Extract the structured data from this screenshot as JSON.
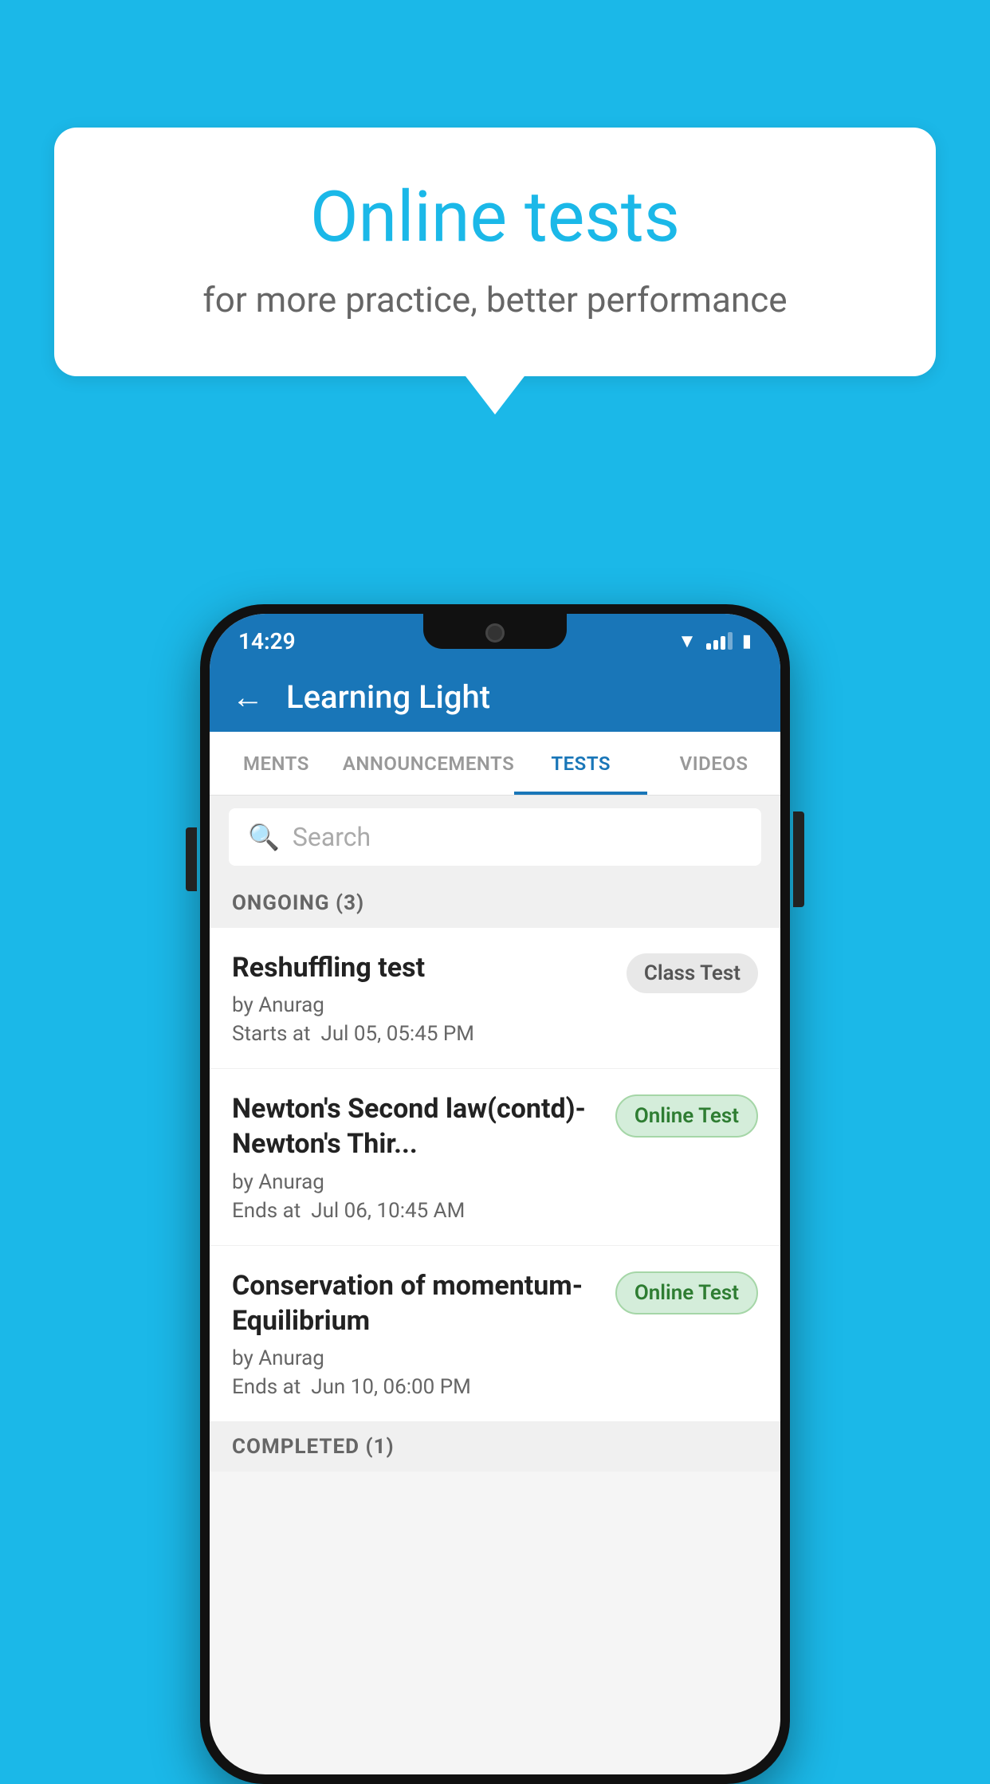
{
  "background": {
    "color": "#1BB8E8"
  },
  "speech_bubble": {
    "title": "Online tests",
    "subtitle": "for more practice, better performance"
  },
  "phone": {
    "status_bar": {
      "time": "14:29"
    },
    "app_bar": {
      "title": "Learning Light",
      "back_label": "←"
    },
    "tabs": [
      {
        "label": "MENTS",
        "active": false
      },
      {
        "label": "ANNOUNCEMENTS",
        "active": false
      },
      {
        "label": "TESTS",
        "active": true
      },
      {
        "label": "VIDEOS",
        "active": false
      }
    ],
    "search": {
      "placeholder": "Search"
    },
    "sections": [
      {
        "header": "ONGOING (3)",
        "items": [
          {
            "name": "Reshuffling test",
            "author": "by Anurag",
            "time_label": "Starts at",
            "time_value": "Jul 05, 05:45 PM",
            "badge": "Class Test",
            "badge_type": "class"
          },
          {
            "name": "Newton's Second law(contd)-Newton's Thir...",
            "author": "by Anurag",
            "time_label": "Ends at",
            "time_value": "Jul 06, 10:45 AM",
            "badge": "Online Test",
            "badge_type": "online"
          },
          {
            "name": "Conservation of momentum-Equilibrium",
            "author": "by Anurag",
            "time_label": "Ends at",
            "time_value": "Jun 10, 06:00 PM",
            "badge": "Online Test",
            "badge_type": "online"
          }
        ]
      }
    ],
    "completed_header": "COMPLETED (1)"
  }
}
